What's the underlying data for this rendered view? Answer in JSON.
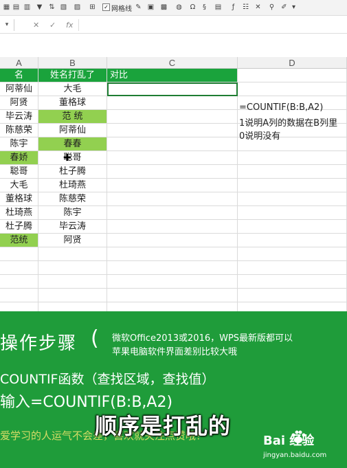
{
  "toolbar": {
    "gridlines_label": "网格线"
  },
  "formula_bar": {
    "name_box": "",
    "cancel_glyph": "✕",
    "confirm_glyph": "✓",
    "fx_glyph": "fx"
  },
  "sheet": {
    "columns": [
      "A",
      "B",
      "C",
      "D"
    ],
    "header_row": {
      "a": "名",
      "b": "姓名打乱了",
      "c": "对比"
    },
    "rows": [
      {
        "a": "阿蒂仙",
        "b": "大毛",
        "a_hl": false,
        "b_hl": false
      },
      {
        "a": "阿贤",
        "b": "董格球",
        "a_hl": false,
        "b_hl": false
      },
      {
        "a": "毕云涛",
        "b": "范  统",
        "a_hl": false,
        "b_hl": true
      },
      {
        "a": "陈慈荣",
        "b": "阿蒂仙",
        "a_hl": false,
        "b_hl": false
      },
      {
        "a": "陈宇",
        "b": "春春",
        "a_hl": false,
        "b_hl": true
      },
      {
        "a": "春娇",
        "b": "聪哥",
        "a_hl": true,
        "b_hl": false
      },
      {
        "a": "聪哥",
        "b": "杜子腾",
        "a_hl": false,
        "b_hl": false
      },
      {
        "a": "大毛",
        "b": "杜琦燕",
        "a_hl": false,
        "b_hl": false
      },
      {
        "a": "董格球",
        "b": "陈慈荣",
        "a_hl": false,
        "b_hl": false
      },
      {
        "a": "杜琦燕",
        "b": "陈宇",
        "a_hl": false,
        "b_hl": false
      },
      {
        "a": "杜子腾",
        "b": "毕云涛",
        "a_hl": false,
        "b_hl": false
      },
      {
        "a": "范统",
        "b": "阿贤",
        "a_hl": true,
        "b_hl": false
      }
    ],
    "notes": [
      "=COUNTIF(B:B,A2)",
      "1说明A列的数据在B列里",
      "0说明没有"
    ],
    "highlight_color": "#92d050",
    "header_color": "#1aa33c"
  },
  "overlay": {
    "title": "操作步骤",
    "paren": "(",
    "note_line1": "微软Office2013或2016，WPS最新版都可以",
    "note_line2": "苹果电脑软件界面差别比较大哦",
    "step_line1": "COUNTIF函数（查找区域，查找值）",
    "step_line2": "输入=COUNTIF(B:B,A2)",
    "step_line3": "爱学习的人运气不会差，喜欢就关注点赞哦！",
    "subtitle": "顺序是打乱的",
    "watermark_brand": "Bai  经验",
    "watermark_url": "jingyan.baidu.com",
    "bg_color": "#1f9c3a"
  }
}
